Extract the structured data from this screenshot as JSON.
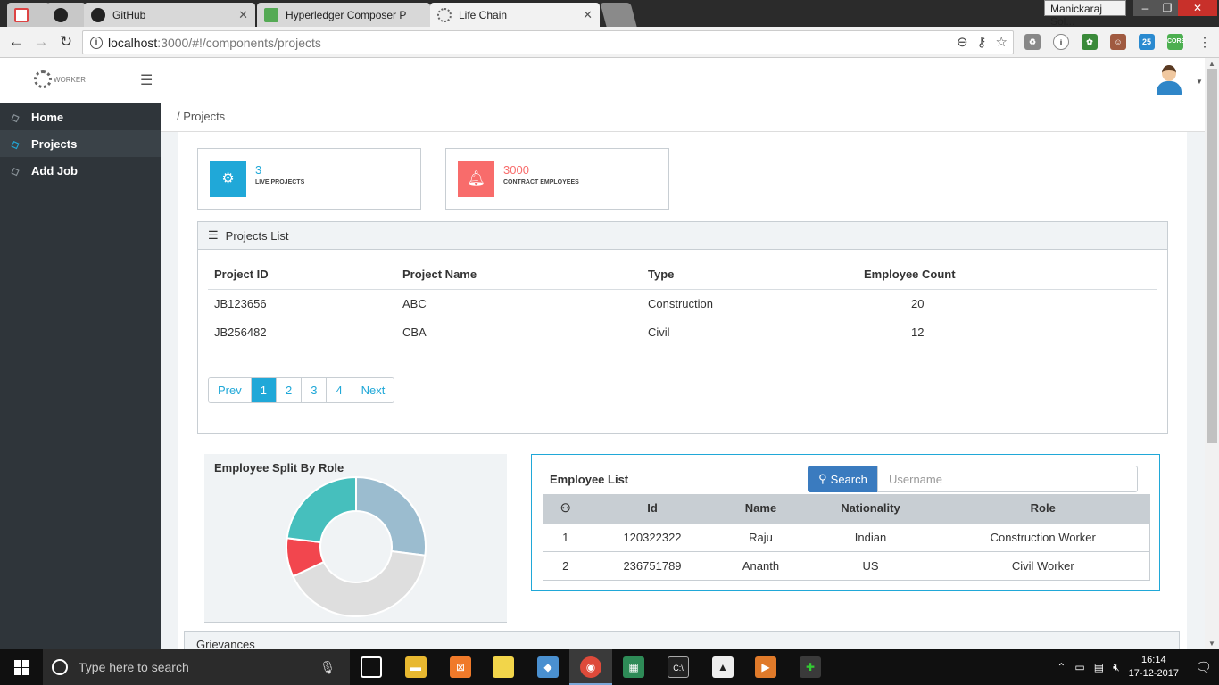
{
  "browser": {
    "tabs": [
      {
        "label": "",
        "icon": "gmail-icon"
      },
      {
        "label": "",
        "icon": "github-icon"
      },
      {
        "label": "GitHub",
        "icon": "github-icon"
      },
      {
        "label": "Hyperledger Composer P",
        "icon": "composer-icon"
      },
      {
        "label": "Life Chain",
        "icon": "lifechain-icon"
      }
    ],
    "profile_name": "Manickaraj Sol...",
    "url_host": "localhost",
    "url_path": ":3000/#!/components/projects",
    "ext_badge_25": "25",
    "ext_badge_cors": "CORS"
  },
  "app": {
    "logo_text": "WORKER",
    "breadcrumb": "/ Projects"
  },
  "sidebar": {
    "items": [
      {
        "label": "Home"
      },
      {
        "label": "Projects"
      },
      {
        "label": "Add Job"
      }
    ]
  },
  "stats": [
    {
      "value": "3",
      "label": "LIVE PROJECTS",
      "color": "#20a8d8"
    },
    {
      "value": "3000",
      "label": "CONTRACT EMPLOYEES",
      "color": "#f86c6b"
    }
  ],
  "projects": {
    "title": "Projects List",
    "headers": [
      "Project ID",
      "Project Name",
      "Type",
      "Employee Count"
    ],
    "rows": [
      [
        "JB123656",
        "ABC",
        "Construction",
        "20"
      ],
      [
        "JB256482",
        "CBA",
        "Civil",
        "12"
      ]
    ],
    "pager": {
      "prev": "Prev",
      "pages": [
        "1",
        "2",
        "3",
        "4"
      ],
      "next": "Next",
      "current": "1"
    }
  },
  "role_split": {
    "title": "Employee Split By Role"
  },
  "chart_data": {
    "type": "pie",
    "title": "Employee Split By Role",
    "values": [
      27,
      41,
      9,
      23
    ],
    "colors": [
      "#9bbccf",
      "#dedede",
      "#f2464e",
      "#46bfbd"
    ]
  },
  "employees": {
    "title": "Employee List",
    "search_label": "Search",
    "search_placeholder": "Username",
    "headers": [
      "",
      "Id",
      "Name",
      "Nationality",
      "Role"
    ],
    "rows": [
      [
        "1",
        "120322322",
        "Raju",
        "Indian",
        "Construction Worker"
      ],
      [
        "2",
        "236751789",
        "Ananth",
        "US",
        "Civil Worker"
      ]
    ]
  },
  "grievances": {
    "title": "Grievances"
  },
  "taskbar": {
    "search_placeholder": "Type here to search",
    "time": "16:14",
    "date": "17-12-2017"
  }
}
